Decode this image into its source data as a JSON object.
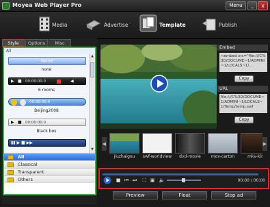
{
  "titlebar": {
    "title": "Moyea Web Player Pro",
    "menu_label": "Menu",
    "minimize": "_",
    "close": "x"
  },
  "toolbar": {
    "items": [
      {
        "label": "Media",
        "icon": "film-strip-icon"
      },
      {
        "label": "Advertise",
        "icon": "megaphone-icon"
      },
      {
        "label": "Template",
        "icon": "template-icon"
      },
      {
        "label": "Publish",
        "icon": "publish-icon"
      }
    ],
    "active": "Template"
  },
  "left_panel": {
    "tabs": [
      "Style",
      "Options",
      "Misc"
    ],
    "active_tab": "Style",
    "list_header": "All",
    "templates": [
      {
        "preview_text": "None",
        "name": "none"
      },
      {
        "preview_text": "00:00:00.0",
        "name": "6 rooms"
      },
      {
        "preview_text": "00:00:00.0",
        "name": "Beijing2008"
      },
      {
        "preview_text": "00:00:00.0",
        "name": "Black box"
      },
      {
        "preview_text": "",
        "name": ""
      }
    ],
    "categories": [
      {
        "label": "All",
        "selected": true
      },
      {
        "label": "Classical",
        "selected": false
      },
      {
        "label": "Transparent",
        "selected": false
      },
      {
        "label": "Others",
        "selected": false
      }
    ]
  },
  "embed": {
    "title": "Embed",
    "code": "<embed src=\"file:///C%3D/DOCUME~1/ADMINI~1/LOCALS~1/...",
    "copy_label": "Copy"
  },
  "url": {
    "title": "URL",
    "code": "file:///C%3D/DOCUME~1/ADMINI~1/LOCALS~1/Temp/temp.swf",
    "copy_label": "Copy"
  },
  "thumbnails": [
    {
      "label": "jiuzhaigou"
    },
    {
      "label": "swf-worldview"
    },
    {
      "label": "dvd-movie"
    },
    {
      "label": "mov-carton"
    },
    {
      "label": "mkv-kin"
    }
  ],
  "player": {
    "timecode": "00:00 / 00:00",
    "progress": 0
  },
  "bottom_buttons": [
    "Preview",
    "Float",
    "Stop ad"
  ],
  "colors": {
    "highlight_red": "#e22222",
    "list_border_green": "#38b838",
    "selected_blue": "#2c6cd6"
  }
}
